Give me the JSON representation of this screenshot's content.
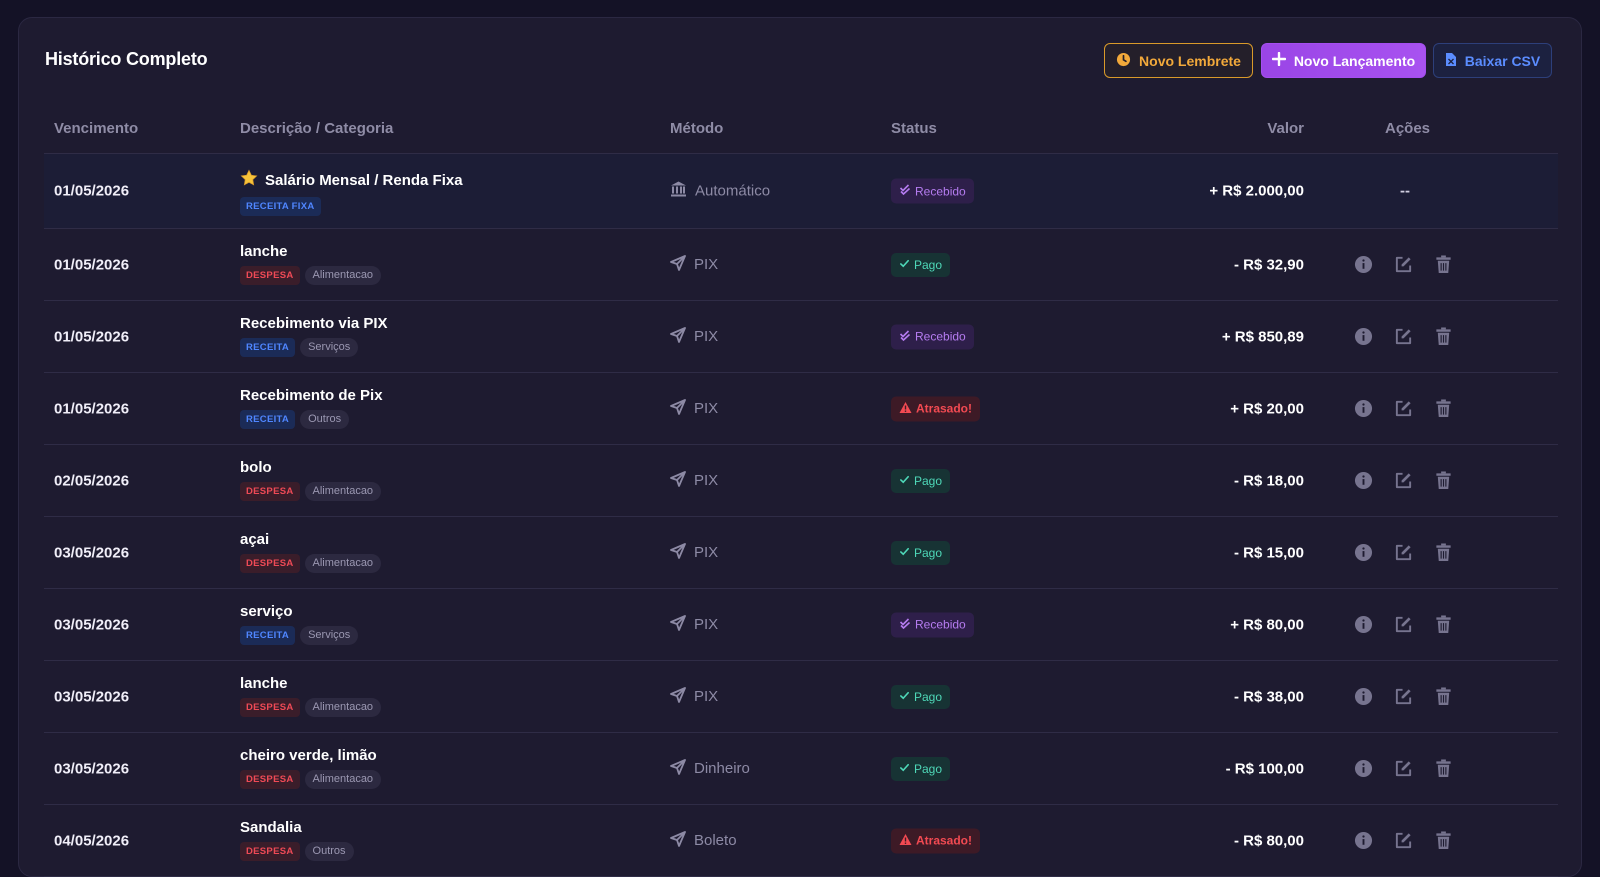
{
  "page": {
    "title": "Histórico Completo"
  },
  "toolbar": {
    "reminder_label": "Novo Lembrete",
    "new_label": "Novo Lançamento",
    "csv_label": "Baixar CSV"
  },
  "table": {
    "headers": {
      "vencimento": "Vencimento",
      "descricao": "Descrição / Categoria",
      "metodo": "Método",
      "status": "Status",
      "valor": "Valor",
      "acoes": "Ações"
    },
    "rows": [
      {
        "date": "01/05/2026",
        "desc": "Salário Mensal / Renda Fixa",
        "type": "RECEITA FIXA",
        "category": "",
        "method": "Automático",
        "status": "Recebido",
        "value": "+ R$ 2.000,00",
        "actions": "--"
      },
      {
        "date": "01/05/2026",
        "desc": "lanche",
        "type": "DESPESA",
        "category": "Alimentacao",
        "method": "PIX",
        "status": "Pago",
        "value": "- R$ 32,90"
      },
      {
        "date": "01/05/2026",
        "desc": "Recebimento via PIX",
        "type": "RECEITA",
        "category": "Serviços",
        "method": "PIX",
        "status": "Recebido",
        "value": "+ R$ 850,89"
      },
      {
        "date": "01/05/2026",
        "desc": "Recebimento de Pix",
        "type": "RECEITA",
        "category": "Outros",
        "method": "PIX",
        "status": "Atrasado!",
        "value": "+ R$ 20,00"
      },
      {
        "date": "02/05/2026",
        "desc": "bolo",
        "type": "DESPESA",
        "category": "Alimentacao",
        "method": "PIX",
        "status": "Pago",
        "value": "- R$ 18,00"
      },
      {
        "date": "03/05/2026",
        "desc": "açai",
        "type": "DESPESA",
        "category": "Alimentacao",
        "method": "PIX",
        "status": "Pago",
        "value": "- R$ 15,00"
      },
      {
        "date": "03/05/2026",
        "desc": "serviço",
        "type": "RECEITA",
        "category": "Serviços",
        "method": "PIX",
        "status": "Recebido",
        "value": "+ R$ 80,00"
      },
      {
        "date": "03/05/2026",
        "desc": "lanche",
        "type": "DESPESA",
        "category": "Alimentacao",
        "method": "PIX",
        "status": "Pago",
        "value": "- R$ 38,00"
      },
      {
        "date": "03/05/2026",
        "desc": "cheiro verde, limão",
        "type": "DESPESA",
        "category": "Alimentacao",
        "method": "Dinheiro",
        "status": "Pago",
        "value": "- R$ 100,00"
      },
      {
        "date": "04/05/2026",
        "desc": "Sandalia",
        "type": "DESPESA",
        "category": "Outros",
        "method": "Boleto",
        "status": "Atrasado!",
        "value": "- R$ 80,00"
      }
    ]
  },
  "colors": {
    "accent": "#a852f0",
    "warning": "#f2a93b",
    "info": "#5b8dff",
    "paid": "#4ed8b8",
    "overdue": "#f24a52"
  }
}
